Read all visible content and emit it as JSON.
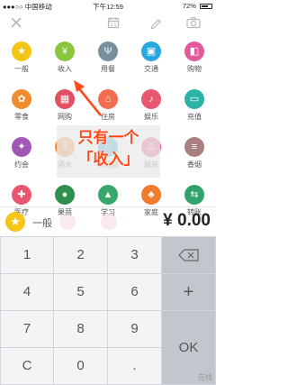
{
  "status": {
    "carrier": "●●●○○ 中国移动 ",
    "time": "下午12:59",
    "battery": "72%",
    "battery_level": 0.72
  },
  "toolbar": {
    "close_icon": "close-icon",
    "calendar_icon": "calendar-icon",
    "edit_icon": "pencil-icon",
    "camera_icon": "camera-icon"
  },
  "categories": [
    {
      "label": "一般",
      "color": "#f5c518",
      "glyph": "★"
    },
    {
      "label": "收入",
      "color": "#8cc63f",
      "glyph": "¥"
    },
    {
      "label": "用餐",
      "color": "#78909c",
      "glyph": "Ψ"
    },
    {
      "label": "交通",
      "color": "#29a8e0",
      "glyph": "▣"
    },
    {
      "label": "购物",
      "color": "#e05a9c",
      "glyph": "◧"
    },
    {
      "label": "零食",
      "color": "#f08c2e",
      "glyph": "✿"
    },
    {
      "label": "网购",
      "color": "#e34f62",
      "glyph": "▦"
    },
    {
      "label": "住房",
      "color": "#f26c4f",
      "glyph": "⌂"
    },
    {
      "label": "娱乐",
      "color": "#e8566f",
      "glyph": "♪"
    },
    {
      "label": "充值",
      "color": "#2db3a6",
      "glyph": "▭"
    },
    {
      "label": "约会",
      "color": "#a157b5",
      "glyph": "✦"
    },
    {
      "label": "酒水",
      "color": "#ef8a3a",
      "glyph": "Ỹ"
    },
    {
      "label": "日用品",
      "color": "#3aa6d8",
      "glyph": "◌"
    },
    {
      "label": "服装",
      "color": "#e04a86",
      "glyph": "♙"
    },
    {
      "label": "香烟",
      "color": "#a97f7f",
      "glyph": "≡"
    },
    {
      "label": "医疗",
      "color": "#e8566f",
      "glyph": "✚"
    },
    {
      "label": "果蔬",
      "color": "#2f8f4f",
      "glyph": "●"
    },
    {
      "label": "学习",
      "color": "#37a86a",
      "glyph": "▲"
    },
    {
      "label": "家庭",
      "color": "#f07a2e",
      "glyph": "♣"
    },
    {
      "label": "转账",
      "color": "#2fa36a",
      "glyph": "⇆"
    }
  ],
  "annotation": {
    "line1": "只有一个",
    "line2": "「收入」"
  },
  "amount_bar": {
    "category": "一般",
    "amount": "¥ 0.00"
  },
  "keypad": {
    "k1": "1",
    "k2": "2",
    "k3": "3",
    "backspace": "⌫",
    "k4": "4",
    "k5": "5",
    "k6": "6",
    "plus": "+",
    "k7": "7",
    "k8": "8",
    "k9": "9",
    "ok": "OK",
    "c": "C",
    "k0": "0",
    "dot": "."
  },
  "watermark": "在线"
}
